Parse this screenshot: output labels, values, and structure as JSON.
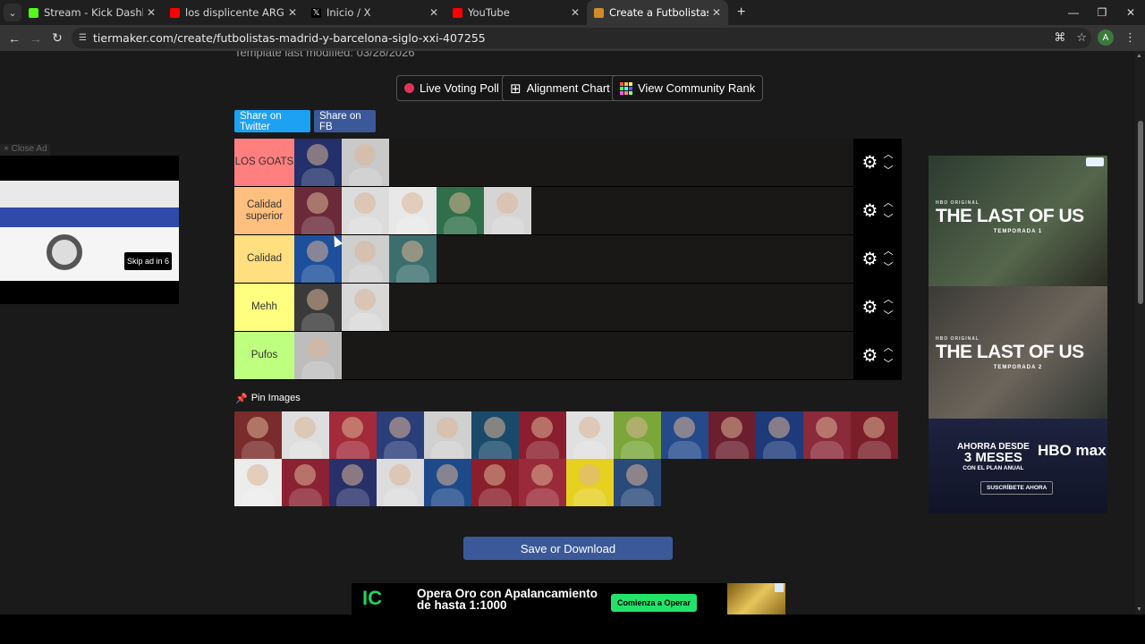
{
  "browser": {
    "tabs": [
      {
        "title": "Stream - Kick Dashboard",
        "color": "#53fc18",
        "active": false
      },
      {
        "title": "los displicente ARGENTIN VS M",
        "color": "#ff0000",
        "active": false
      },
      {
        "title": "Inicio / X",
        "color": "#000000",
        "active": false
      },
      {
        "title": "YouTube",
        "color": "#ff0000",
        "active": false
      },
      {
        "title": "Create a Futbolistas madrid y b",
        "color": "#d08a2a",
        "active": true
      }
    ],
    "url": "tiermaker.com/create/futbolistas-madrid-y-barcelona-siglo-xxi-407255",
    "avatar_letter": "A"
  },
  "page": {
    "modified_text": "Template last modified: 03/28/2026",
    "buttons": {
      "live_voting": "Live Voting Poll",
      "alignment": "Alignment Chart",
      "community": "View Community Rank"
    },
    "share_twitter": "Share on Twitter",
    "share_fb": "Share on FB",
    "pin_images": "Pin Images",
    "save": "Save or Download"
  },
  "tiers": [
    {
      "label": "LOS GOATS",
      "color": "#ff7f7f",
      "images": [
        "#23306b",
        "#c9c9c9"
      ]
    },
    {
      "label": "Calidad superior",
      "color": "#ffbf7f",
      "images": [
        "#6b2a3a",
        "#dcdcdc",
        "#e8e8e8",
        "#2f6f4a",
        "#d5d5d5"
      ]
    },
    {
      "label": "Calidad",
      "color": "#ffdf7f",
      "images": [
        "#1d4f9c",
        "#cfcfcf",
        "#3c6e6e"
      ]
    },
    {
      "label": "Mehh",
      "color": "#ffff7f",
      "images": [
        "#3a3a3a",
        "#d8d8d8"
      ]
    },
    {
      "label": "Pufos",
      "color": "#bfff7f",
      "images": [
        "#bdbdbd"
      ]
    }
  ],
  "pool": [
    "#7a2b2b",
    "#dedede",
    "#a22a3a",
    "#2a3e7a",
    "#d0d0d0",
    "#1a4a6a",
    "#8a1e2e",
    "#e0e0e0",
    "#7aa63a",
    "#244a8a",
    "#6a1e2e",
    "#1e3a7a",
    "#8a2a3a",
    "#7a1e2a",
    "#ececec",
    "#8a2233",
    "#28306a",
    "#dcdcdc",
    "#1e4a8a",
    "#8a1e2a",
    "#9a2a3a",
    "#e6d020",
    "#2a4a7a"
  ],
  "ads": {
    "close_ad": "× Close Ad",
    "skip": "Skip ad in 6",
    "hbo_small": "HBO ORIGINAL",
    "hbo_title": "THE LAST OF US",
    "season1": "TEMPORADA 1",
    "season2": "TEMPORADA 2",
    "desde_line1": "AHORRA DESDE",
    "desde_line2": "3 MESES",
    "desde_line3": "CON EL PLAN ANUAL",
    "hbomax": "HBO max",
    "subscribe": "SUSCRÍBETE AHORA",
    "banner_logo": "IC",
    "banner_text_1": "Opera Oro con Apalancamiento",
    "banner_text_2": "de hasta 1:1000",
    "banner_cta": "Comienza a Operar"
  }
}
